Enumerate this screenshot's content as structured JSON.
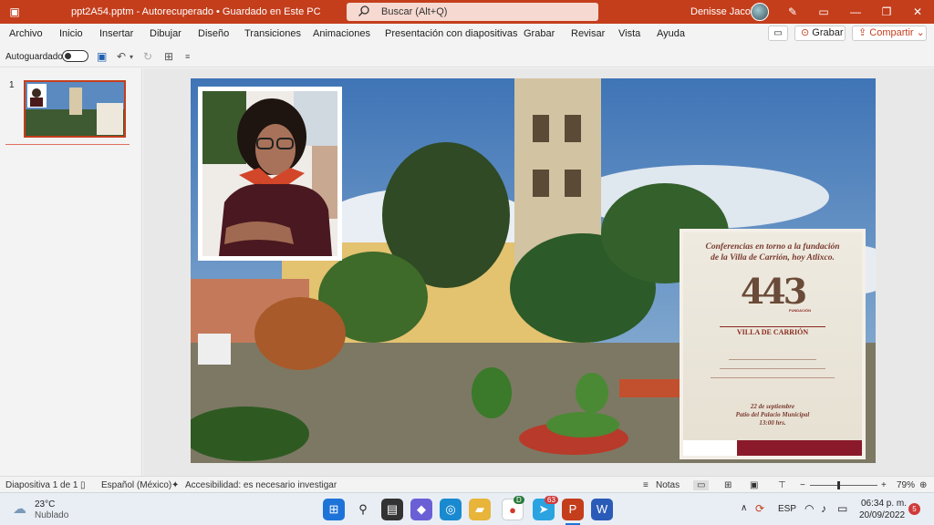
{
  "titlebar": {
    "title": "ppt2A54.pptm  -  Autorecuperado • Guardado en Este PC",
    "search_placeholder": "Buscar (Alt+Q)",
    "user_name": "Denisse Jacobo"
  },
  "ribbon": {
    "tabs": [
      "Archivo",
      "Inicio",
      "Insertar",
      "Dibujar",
      "Diseño",
      "Transiciones",
      "Animaciones",
      "Presentación con diapositivas",
      "Grabar",
      "Revisar",
      "Vista",
      "Ayuda"
    ],
    "grabar_button": "Grabar",
    "compartir_button": "Compartir"
  },
  "quick_access": {
    "autosave_label": "Autoguardado"
  },
  "thumbnails": {
    "slide_number": "1"
  },
  "slide": {
    "poster": {
      "title_line1": "Conferencias en torno a la fundación",
      "title_line2": "de la Villa de Carrión, hoy Atlixco.",
      "number": "443",
      "number_sub": "FUNDACIÓN",
      "villa": "VILLA DE CARRIÓN",
      "date_line1": "22 de septiembre",
      "date_line2": "Patio del Palacio Municipal",
      "date_line3": "13:00 hrs."
    }
  },
  "statusbar": {
    "slide_info": "Diapositiva 1 de 1",
    "language": "Español (México)",
    "accessibility": "Accesibilidad: es necesario investigar",
    "notes": "Notas",
    "zoom": "79%"
  },
  "taskbar": {
    "weather_temp": "23°C",
    "weather_desc": "Nublado",
    "lang": "ESP",
    "time": "06:34 p. m.",
    "date": "20/09/2022",
    "notif_count": "5",
    "telegram_badge": "63",
    "chrome_badge": "D"
  },
  "colors": {
    "titlebar": "#c43e1c",
    "accent": "#c43e1c"
  }
}
